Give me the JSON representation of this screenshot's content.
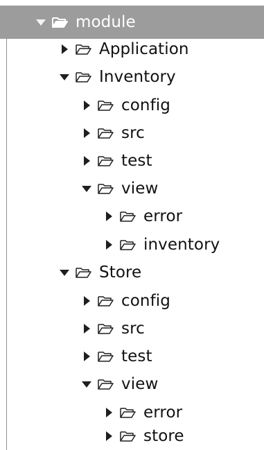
{
  "tree": {
    "items": [
      {
        "label": "module",
        "expanded": true,
        "selected": true,
        "icon": "folder-open-icon"
      },
      {
        "label": "Application",
        "expanded": false,
        "icon": "folder-open-icon"
      },
      {
        "label": "Inventory",
        "expanded": true,
        "icon": "folder-open-icon"
      },
      {
        "label": "config",
        "expanded": false,
        "icon": "folder-open-icon"
      },
      {
        "label": "src",
        "expanded": false,
        "icon": "folder-open-icon"
      },
      {
        "label": "test",
        "expanded": false,
        "icon": "folder-open-icon"
      },
      {
        "label": "view",
        "expanded": true,
        "icon": "folder-open-icon"
      },
      {
        "label": "error",
        "expanded": false,
        "icon": "folder-open-icon"
      },
      {
        "label": "inventory",
        "expanded": false,
        "icon": "folder-open-icon"
      },
      {
        "label": "Store",
        "expanded": true,
        "icon": "folder-open-icon"
      },
      {
        "label": "config",
        "expanded": false,
        "icon": "folder-open-icon"
      },
      {
        "label": "src",
        "expanded": false,
        "icon": "folder-open-icon"
      },
      {
        "label": "test",
        "expanded": false,
        "icon": "folder-open-icon"
      },
      {
        "label": "view",
        "expanded": true,
        "icon": "folder-open-icon"
      },
      {
        "label": "error",
        "expanded": false,
        "icon": "folder-open-icon"
      },
      {
        "label": "store",
        "expanded": false,
        "icon": "folder-open-icon"
      }
    ]
  },
  "colors": {
    "selection": "#9c9c9c",
    "text": "#111111",
    "selected_text": "#ffffff"
  }
}
